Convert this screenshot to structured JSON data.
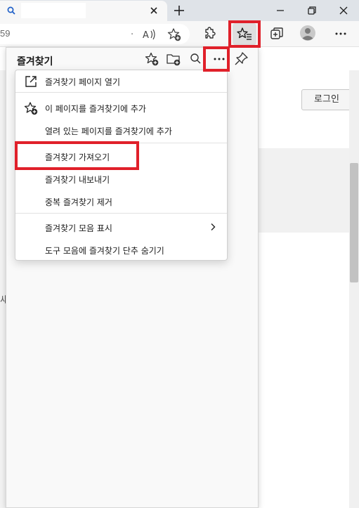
{
  "toolbar": {
    "url_fragment": "59",
    "url_dot": "."
  },
  "page": {
    "login_label": "로그인",
    "left_glyph": "새"
  },
  "favorites": {
    "title": "즐겨찾기"
  },
  "menu": {
    "items": [
      {
        "label": "즐겨찾기 페이지 열기",
        "icon": "open-external-icon"
      },
      {
        "label": "이 페이지를 즐겨찾기에 추가",
        "icon": "star-add-icon"
      },
      {
        "label": "열려 있는 페이지를 즐겨찾기에 추가",
        "icon": ""
      },
      {
        "label": "즐겨찾기 가져오기",
        "icon": ""
      },
      {
        "label": "즐겨찾기 내보내기",
        "icon": ""
      },
      {
        "label": "중복 즐겨찾기 제거",
        "icon": ""
      },
      {
        "label": "즐겨찾기 모음 표시",
        "icon": "chevron-right-icon"
      },
      {
        "label": "도구 모음에 즐겨찾기 단추 숨기기",
        "icon": ""
      }
    ]
  },
  "colors": {
    "highlight": "#e0202a",
    "titlebar": "#dfe3e8",
    "toolbar": "#f7f7f7"
  }
}
